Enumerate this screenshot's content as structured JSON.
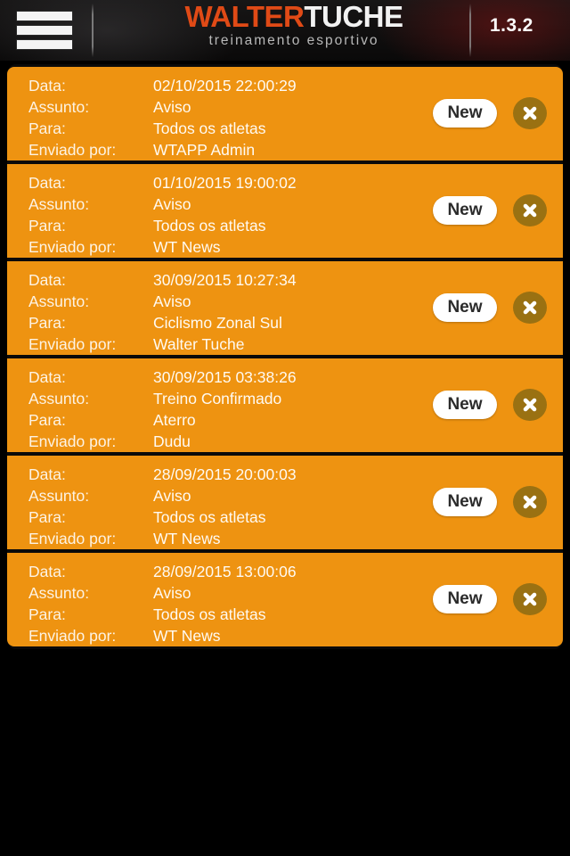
{
  "header": {
    "menu_icon": "hamburger-menu-icon",
    "logo_part1": "WALTER",
    "logo_part2": "TUCHE",
    "logo_tagline": "treinamento esportivo",
    "version": "1.3.2",
    "colors": {
      "logo_orange": "#e04a16",
      "logo_white": "#f2f2f2",
      "background": "#111010"
    }
  },
  "list": {
    "labels": {
      "date": "Data:",
      "subject": "Assunto:",
      "to": "Para:",
      "sender": "Enviado por:"
    },
    "badge_label": "New",
    "delete_icon": "close-x-icon",
    "colors": {
      "card": "#ee9311",
      "badge_bg": "#ffffff",
      "delete_bg": "#9a7112"
    },
    "messages": [
      {
        "date": "02/10/2015 22:00:29",
        "subject": "Aviso",
        "to": "Todos os atletas",
        "sender": "WTAPP Admin",
        "badge": "New"
      },
      {
        "date": "01/10/2015 19:00:02",
        "subject": "Aviso",
        "to": "Todos os atletas",
        "sender": "WT News",
        "badge": "New"
      },
      {
        "date": "30/09/2015 10:27:34",
        "subject": "Aviso",
        "to": "Ciclismo Zonal Sul",
        "sender": "Walter Tuche",
        "badge": "New"
      },
      {
        "date": "30/09/2015 03:38:26",
        "subject": "Treino Confirmado",
        "to": "Aterro",
        "sender": "Dudu",
        "badge": "New"
      },
      {
        "date": "28/09/2015 20:00:03",
        "subject": "Aviso",
        "to": "Todos os atletas",
        "sender": "WT News",
        "badge": "New"
      },
      {
        "date": "28/09/2015 13:00:06",
        "subject": "Aviso",
        "to": "Todos os atletas",
        "sender": "WT News",
        "badge": "New"
      }
    ]
  }
}
